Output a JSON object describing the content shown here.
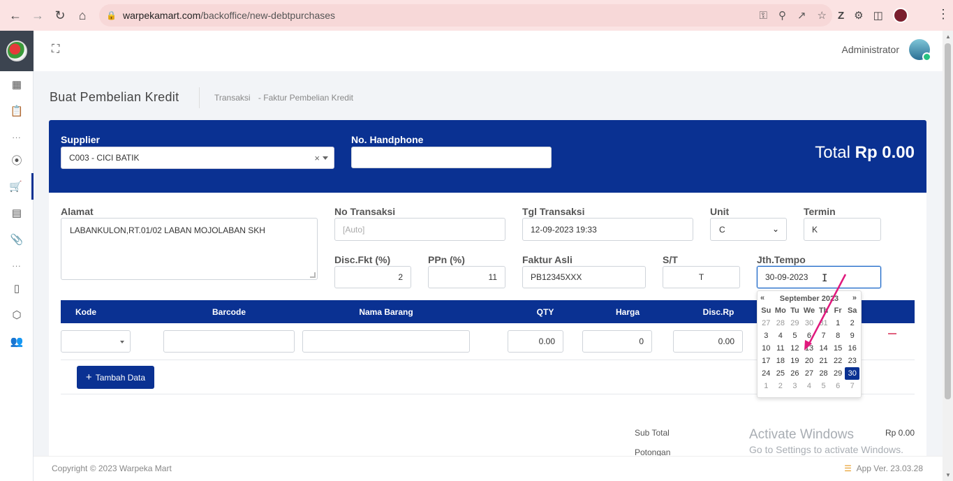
{
  "browser": {
    "url_host": "warpekamart.com",
    "url_path": "/backoffice/new-debtpurchases"
  },
  "header": {
    "user_name": "Administrator"
  },
  "page": {
    "title": "Buat Pembelian Kredit",
    "breadcrumb": [
      "Transaksi",
      "-  Faktur Pembelian Kredit"
    ]
  },
  "form": {
    "supplier_label": "Supplier",
    "supplier_value": "C003 - CICI BATIK",
    "supplier_clear": "×",
    "handphone_label": "No. Handphone",
    "handphone_value": "",
    "total_label": "Total",
    "total_value": "Rp 0.00",
    "alamat_label": "Alamat",
    "alamat_value": "LABANKULON,RT.01/02 LABAN MOJOLABAN SKH",
    "no_transaksi_label": "No Transaksi",
    "no_transaksi_placeholder": "[Auto]",
    "tgl_transaksi_label": "Tgl Transaksi",
    "tgl_transaksi_value": "12-09-2023 19:33",
    "unit_label": "Unit",
    "unit_value": "C",
    "termin_label": "Termin",
    "termin_value": "K",
    "disc_label": "Disc.Fkt (%)",
    "disc_value": "2",
    "ppn_label": "PPn (%)",
    "ppn_value": "11",
    "faktur_label": "Faktur Asli",
    "faktur_value": "PB12345XXX",
    "st_label": "S/T",
    "st_value": "T",
    "jth_label": "Jth.Tempo",
    "jth_value": "30-09-2023"
  },
  "table": {
    "columns": [
      "Kode",
      "Barcode",
      "Nama Barang",
      "QTY",
      "Harga",
      "Disc.Rp"
    ],
    "row": {
      "qty": "0.00",
      "harga": "0",
      "disc": "0.00"
    },
    "add_button": "Tambah Data"
  },
  "summary": {
    "subtotal_label": "Sub Total",
    "subtotal_value": "Rp 0.00",
    "potongan_label": "Potongan"
  },
  "watermark": {
    "line1": "Activate Windows",
    "line2": "Go to Settings to activate Windows."
  },
  "footer": {
    "copyright": "Copyright © 2023 Warpeka Mart",
    "version": "App Ver. 23.03.28"
  },
  "datepicker": {
    "prev": "«",
    "next": "»",
    "month": "September 2023",
    "dow": [
      "Su",
      "Mo",
      "Tu",
      "We",
      "Th",
      "Fr",
      "Sa"
    ],
    "days": [
      [
        "27",
        "28",
        "29",
        "30",
        "31",
        "1",
        "2"
      ],
      [
        "3",
        "4",
        "5",
        "6",
        "7",
        "8",
        "9"
      ],
      [
        "10",
        "11",
        "12",
        "13",
        "14",
        "15",
        "16"
      ],
      [
        "17",
        "18",
        "19",
        "20",
        "21",
        "22",
        "23"
      ],
      [
        "24",
        "25",
        "26",
        "27",
        "28",
        "29",
        "30"
      ],
      [
        "1",
        "2",
        "3",
        "4",
        "5",
        "6",
        "7"
      ]
    ],
    "selected": "30",
    "accent": "#0a3192"
  },
  "colors": {
    "primary": "#0a3192",
    "annotation_arrow": "#e0197d"
  }
}
